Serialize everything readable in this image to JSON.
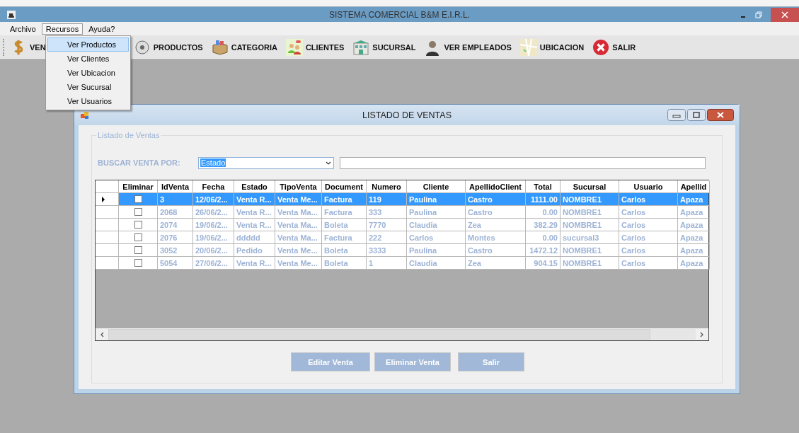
{
  "window": {
    "title": "SISTEMA COMERCIAL B&M E.I.R.L."
  },
  "menu": [
    {
      "label": "Archivo",
      "selected": false
    },
    {
      "label": "Recursos",
      "selected": true
    },
    {
      "label": "Ayuda?",
      "selected": false
    }
  ],
  "dropdown": [
    {
      "label": "Ver Productos",
      "selected": true
    },
    {
      "label": "Ver Clientes",
      "selected": false
    },
    {
      "label": "Ver Ubicacion",
      "selected": false
    },
    {
      "label": "Ver Sucursal",
      "selected": false
    },
    {
      "label": "Ver Usuarios",
      "selected": false
    }
  ],
  "toolbar": [
    {
      "label": "VEN",
      "kind": "dollar"
    },
    {
      "label": "PRODUCTOS",
      "kind": "product"
    },
    {
      "label": "CATEGORIA",
      "kind": "box"
    },
    {
      "label": "CLIENTES",
      "kind": "people"
    },
    {
      "label": "SUCURSAL",
      "kind": "building"
    },
    {
      "label": "VER EMPLEADOS",
      "kind": "person"
    },
    {
      "label": "UBICACION",
      "kind": "map"
    },
    {
      "label": "SALIR",
      "kind": "exit"
    }
  ],
  "child_window": {
    "title": "LISTADO DE VENTAS",
    "group_title": "Listado de Ventas",
    "search_label": "BUSCAR VENTA POR:",
    "search_by": "Estado",
    "table": {
      "checkbox_column": "Eliminar",
      "columns": [
        "IdVenta",
        "Fecha",
        "Estado",
        "TipoVenta",
        "Document",
        "Numero",
        "Cliente",
        "ApellidoClient",
        "Total",
        "Sucursal",
        "Usuario",
        "Apellid"
      ],
      "rows": [
        {
          "selected": true,
          "checked": false,
          "cells": [
            "3",
            "12/06/2...",
            "Venta R...",
            "Venta Me...",
            "Factura",
            "119",
            "Paulina",
            "Castro",
            "1111.00",
            "NOMBRE1",
            "Carlos",
            "Apaza"
          ]
        },
        {
          "selected": false,
          "checked": false,
          "cells": [
            "2068",
            "26/06/2...",
            "Venta R...",
            "Venta Ma...",
            "Factura",
            "333",
            "Paulina",
            "Castro",
            "0.00",
            "NOMBRE1",
            "Carlos",
            "Apaza"
          ]
        },
        {
          "selected": false,
          "checked": false,
          "cells": [
            "2074",
            "19/06/2...",
            "Venta R...",
            "Venta Ma...",
            "Boleta",
            "7770",
            "Claudia",
            "Zea",
            "382.29",
            "NOMBRE1",
            "Carlos",
            "Apaza"
          ]
        },
        {
          "selected": false,
          "checked": false,
          "cells": [
            "2076",
            "19/06/2...",
            "ddddd",
            "Venta Ma...",
            "Factura",
            "222",
            "Carlos",
            "Montes",
            "0.00",
            "sucursal3",
            "Carlos",
            "Apaza"
          ]
        },
        {
          "selected": false,
          "checked": false,
          "cells": [
            "3052",
            "20/06/2...",
            "Pedido",
            "Venta Me...",
            "Boleta",
            "3333",
            "Paulina",
            "Castro",
            "1472.12",
            "NOMBRE1",
            "Carlos",
            "Apaza"
          ]
        },
        {
          "selected": false,
          "checked": false,
          "cells": [
            "5054",
            "27/06/2...",
            "Venta R...",
            "Venta Me...",
            "Boleta",
            "1",
            "Claudia",
            "Zea",
            "904.15",
            "NOMBRE1",
            "Carlos",
            "Apaza"
          ]
        }
      ]
    },
    "buttons": [
      "Editar Venta",
      "Eliminar Venta",
      "Salir"
    ]
  }
}
